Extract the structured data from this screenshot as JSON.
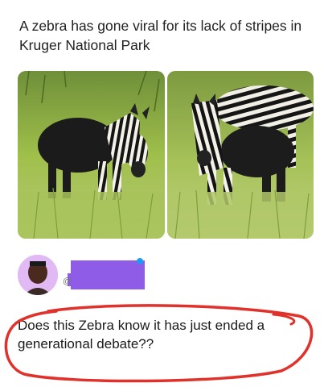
{
  "post": {
    "headline": "A zebra has gone viral for its lack of stripes in Kruger National Park",
    "images": [
      {
        "icon": "zebra-photo-icon"
      },
      {
        "icon": "zebra-photo-icon"
      }
    ]
  },
  "reply": {
    "avatar_icon": "user-avatar-icon",
    "handle_prefix": "@",
    "text": "Does this Zebra know it has just ended a generational debate??"
  },
  "colors": {
    "redaction": "#8f5ce8",
    "annotation": "#e0312b",
    "grass": "#9fbf4a"
  }
}
